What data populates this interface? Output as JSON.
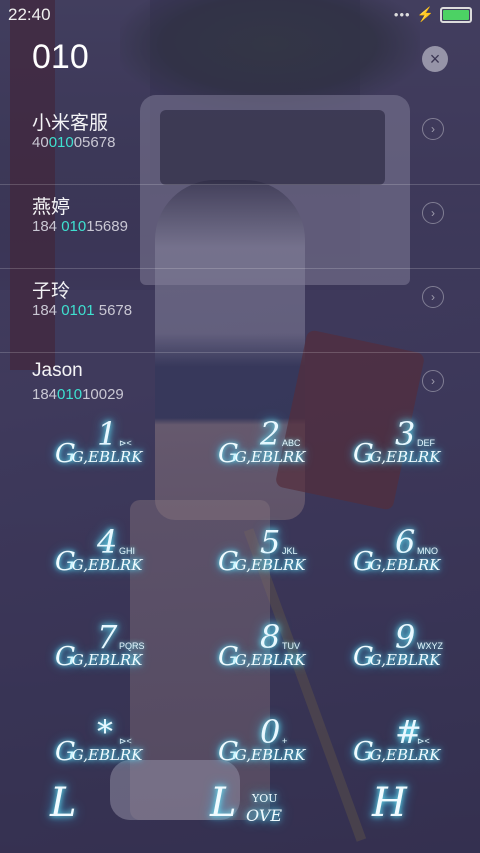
{
  "status": {
    "time": "22:40",
    "signal": "•••",
    "charge": "⚡"
  },
  "dialer": {
    "number": "010",
    "clear_icon": "×"
  },
  "results": [
    {
      "name": "小米客服",
      "num_pre": "40",
      "num_hl": "010",
      "num_post": "05678"
    },
    {
      "name": "燕婷",
      "num_pre": "184 ",
      "num_hl": "010",
      "num_post": "15689"
    },
    {
      "name": "子玲",
      "num_pre": "184 ",
      "num_hl": "0101",
      "num_post": " 5678"
    },
    {
      "name": "Jason",
      "num_pre": "184",
      "num_hl": "010",
      "num_post": "10029"
    }
  ],
  "keypad": {
    "brand_text": "G,EBLRK",
    "brand_big": "G",
    "keys": [
      {
        "digit": "1",
        "letters": "⊳<"
      },
      {
        "digit": "2",
        "letters": "ABC"
      },
      {
        "digit": "3",
        "letters": "DEF"
      },
      {
        "digit": "4",
        "letters": "GHI"
      },
      {
        "digit": "5",
        "letters": "JKL"
      },
      {
        "digit": "6",
        "letters": "MNO"
      },
      {
        "digit": "7",
        "letters": "PQRS"
      },
      {
        "digit": "8",
        "letters": "TUV"
      },
      {
        "digit": "9",
        "letters": "WXYZ"
      },
      {
        "digit": "*",
        "letters": "⊳<"
      },
      {
        "digit": "0",
        "letters": "+"
      },
      {
        "digit": "#",
        "letters": "⊳<"
      }
    ]
  },
  "bottom": {
    "left": "L",
    "mid_l": "L",
    "mid_you": "YOU",
    "mid_ove": "OVE",
    "right": "H"
  },
  "colors": {
    "highlight": "#3ee0d0",
    "battery": "#4cd264",
    "glow": "#6ef2ff"
  }
}
